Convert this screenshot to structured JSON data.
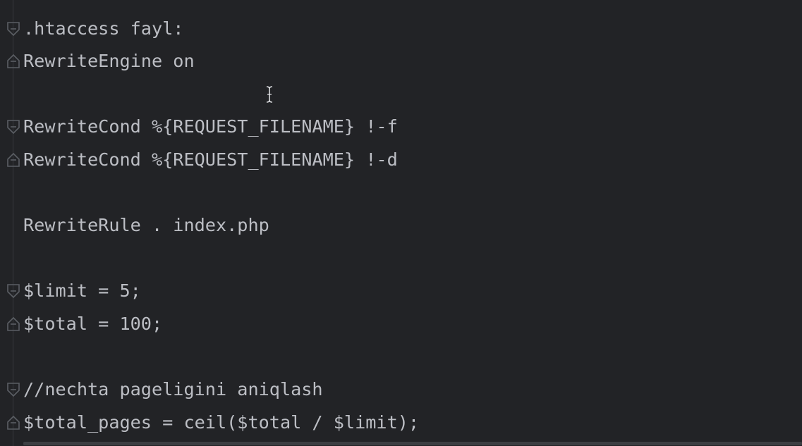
{
  "editor": {
    "lines": [
      {
        "text": ".htaccess fayl:",
        "fold": "start"
      },
      {
        "text": "RewriteEngine on",
        "fold": "end"
      },
      {
        "text": "",
        "fold": "none"
      },
      {
        "text": "RewriteCond %{REQUEST_FILENAME} !-f",
        "fold": "start"
      },
      {
        "text": "RewriteCond %{REQUEST_FILENAME} !-d",
        "fold": "end"
      },
      {
        "text": "",
        "fold": "none"
      },
      {
        "text": "RewriteRule . index.php",
        "fold": "none"
      },
      {
        "text": "",
        "fold": "none"
      },
      {
        "text": "$limit = 5;",
        "fold": "start"
      },
      {
        "text": "$total = 100;",
        "fold": "end"
      },
      {
        "text": "",
        "fold": "none"
      },
      {
        "text": "//nechta pageligini aniqlash",
        "fold": "start"
      },
      {
        "text": "$total_pages = ceil($total / $limit);",
        "fold": "end"
      }
    ],
    "colors": {
      "background": "#222326",
      "text": "#bcbec4",
      "gutter_icon": "#5b5e64"
    },
    "cursor": "text-cursor-icon"
  }
}
